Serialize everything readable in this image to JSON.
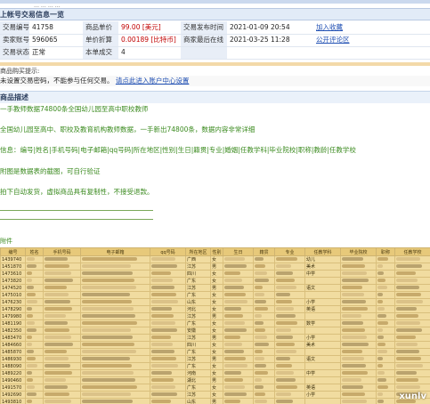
{
  "breadcrumb": "…  …  …  …",
  "info_title": "上帐号交易信息一览",
  "info_rows": [
    {
      "l1": "交易编号",
      "v1": "41758",
      "l2": "商品单价",
      "v2": "99.00 [美元]",
      "l3": "交易发布时间",
      "v3": "2021-01-09 20:54",
      "action": "加入收藏"
    },
    {
      "l1": "卖家账号",
      "v1": "596065",
      "l2": "单价折算",
      "v2": "0.00189 [比特币]",
      "l3": "商家最后在线",
      "v3": "2021-03-25 11:28",
      "action": "公开评论区"
    },
    {
      "l1": "交易状态",
      "v1": "正常",
      "l2": "本单成交",
      "v2": "4",
      "l3": "",
      "v3": "",
      "action": ""
    }
  ],
  "notice": {
    "head": "商品购买提示:",
    "text_prefix": "未设置交易密码，不能参与任何交易。",
    "link": "请点此进入账户中心设置"
  },
  "desc": {
    "head": "商品描述",
    "lines": [
      "一手教师数据74800条全国幼儿园至高中职校教师",
      "全国幼儿园至高中、职校及教育机构教师数据，一手新出74800条，数据内容非常详细",
      "信息：编号|姓名|手机号码|电子邮箱|qq号码|所在地区|性别|生日|籍贯|专业|婚姻|任教学科|毕业院校|职称|教龄|任教学校",
      "附图是数据表的截图，可自行验证",
      "拍下自动发货，虚拟商品具有复制性，不接受退款。"
    ]
  },
  "attach_label": "附件",
  "sheet": {
    "headers": [
      "编号",
      "姓名",
      "手机号码",
      "电子邮箱",
      "qq号码",
      "所在地区",
      "性别",
      "生日",
      "籍贯",
      "专业",
      "任教学科",
      "毕业院校",
      "职称",
      "任教学校"
    ],
    "row_count": 22,
    "col_region": [
      "广西",
      "江苏",
      "四川",
      "广东",
      "江苏",
      "广东",
      "山东",
      "河北",
      "江苏",
      "广东",
      "安徽",
      "江苏",
      "四川",
      "广东",
      "江苏",
      "广东",
      "河南",
      "湖北",
      "广东",
      "江苏",
      "山东",
      "广东"
    ],
    "col_gender": [
      "女",
      "男",
      "女",
      "女",
      "男",
      "女",
      "女",
      "女",
      "男",
      "女",
      "女",
      "男",
      "女",
      "女",
      "男",
      "女",
      "女",
      "男",
      "女",
      "女",
      "男",
      "女"
    ],
    "col_subject": [
      "幼儿",
      "美术",
      "中学",
      "",
      "语文",
      "",
      "小学",
      "英语",
      "",
      "数学",
      "",
      "小学",
      "美术",
      "",
      "语文",
      "",
      "中学",
      "",
      "英语",
      "小学",
      "",
      "美术"
    ],
    "col_id": [
      "1439740",
      "1451870",
      "1473610",
      "1473820",
      "1474520",
      "1475010",
      "1476230",
      "1478290",
      "1479980",
      "1481190",
      "1482350",
      "1483470",
      "1484660",
      "1485870",
      "1486930",
      "1488090",
      "1489220",
      "1490460",
      "1491570",
      "1492690",
      "1493810",
      "1494930"
    ]
  },
  "watermark": "xunlv",
  "colors": {
    "label_bg": "#e8eef7",
    "price": "#c00000",
    "link": "#1f4fb3",
    "desc_text": "#3a8a1e",
    "sheet_bg": "#f1dca0"
  }
}
